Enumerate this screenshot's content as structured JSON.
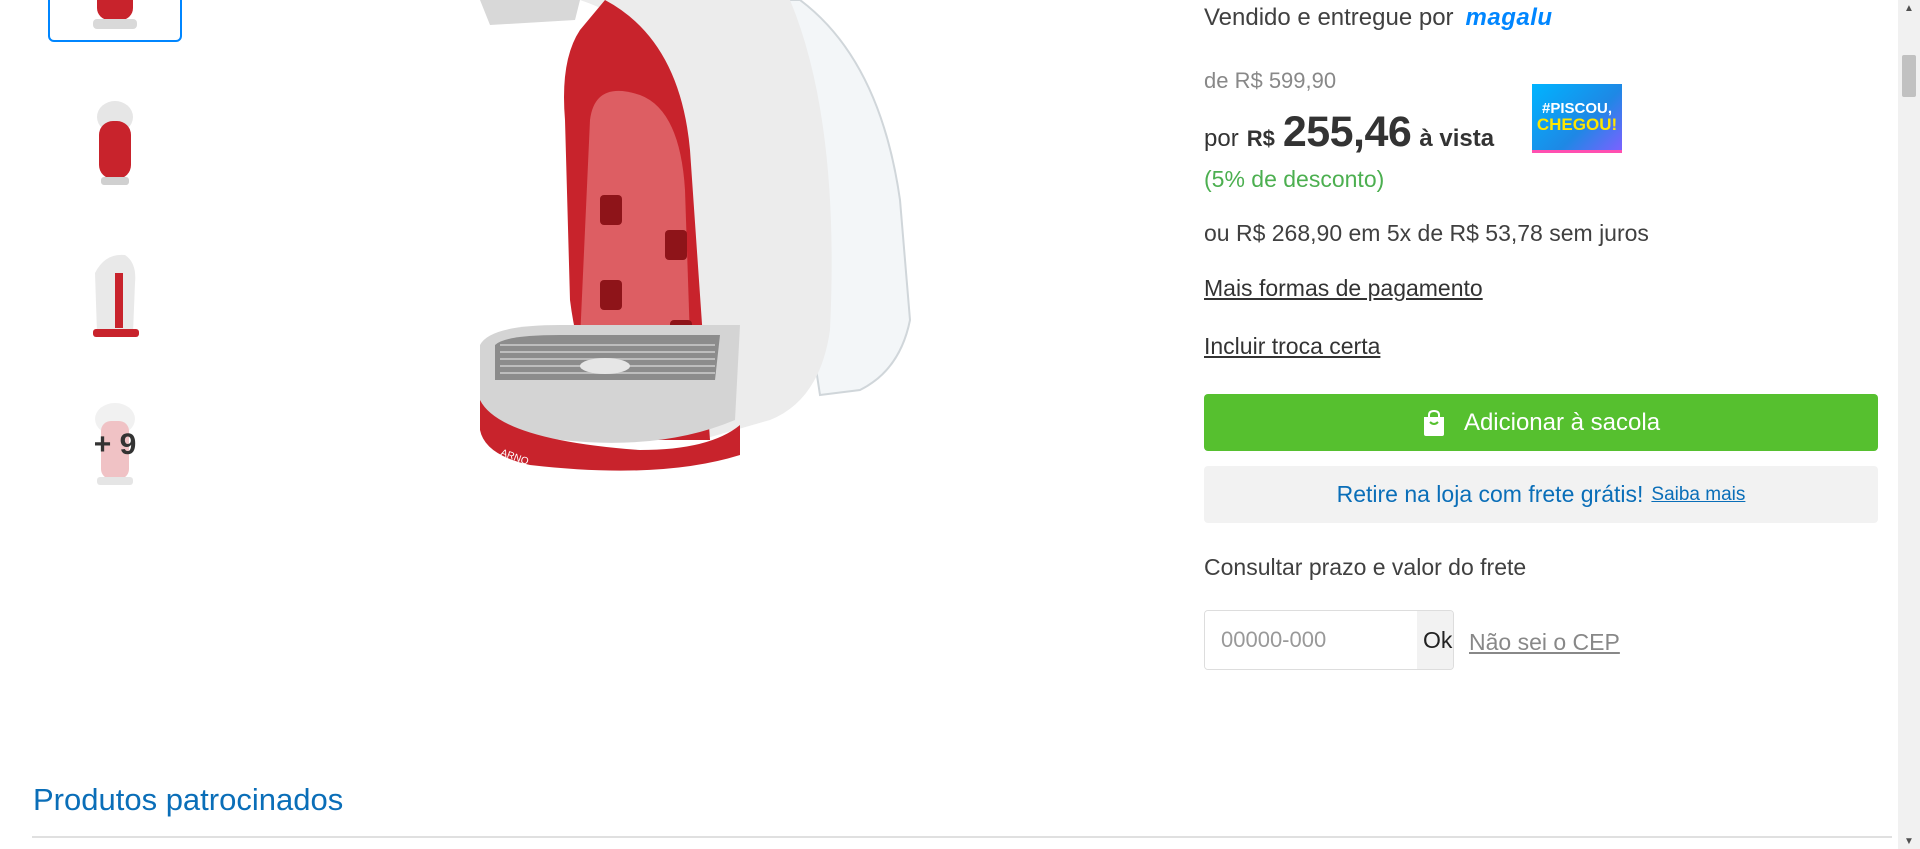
{
  "thumbnails": {
    "more_label": "+ 9"
  },
  "main_image": {
    "brand_text": "ARNO"
  },
  "seller": {
    "label": "Vendido e entregue por",
    "logo_text": "magalu"
  },
  "pricing": {
    "old_price": "de R$ 599,90",
    "por_label": "por",
    "currency": "R$",
    "value": "255,46",
    "vista_label": "à vista",
    "discount": "(5% de desconto)",
    "installments": "ou R$ 268,90 em 5x de R$ 53,78 sem juros"
  },
  "badge": {
    "line1": "#PISCOU,",
    "line2": "CHEGOU!"
  },
  "links": {
    "payment_methods": "Mais formas de pagamento",
    "troca_certa": "Incluir troca certa"
  },
  "add_to_bag": {
    "label": "Adicionar à sacola"
  },
  "pickup": {
    "text": "Retire na loja com frete grátis!",
    "link": "Saiba mais"
  },
  "shipping": {
    "label": "Consultar prazo e valor do frete",
    "placeholder": "00000-000",
    "ok_label": "Ok",
    "unknown_cep": "Não sei o CEP"
  },
  "sponsored": {
    "title": "Produtos patrocinados"
  },
  "colors": {
    "accent_blue": "#0086ff",
    "green_button": "#56c02f",
    "discount_green": "#4caf50",
    "product_red": "#c8232c"
  }
}
